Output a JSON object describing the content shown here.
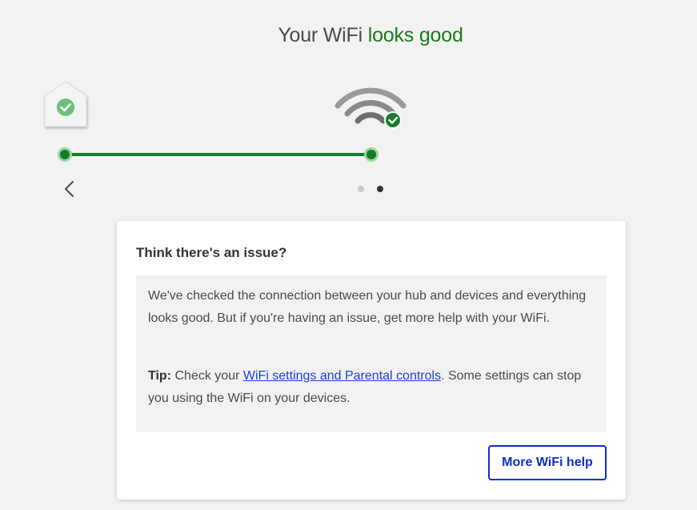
{
  "header": {
    "title_prefix": "Your WiFi ",
    "title_highlight": "looks good"
  },
  "diagram": {
    "hub_icon": "house-hub-icon",
    "wifi_icon": "wifi-signal-icon",
    "status_icon": "check-circle-icon"
  },
  "carousel": {
    "back_icon": "chevron-left-icon",
    "page_count": 2,
    "active_page": 2
  },
  "card": {
    "heading": "Think there's an issue?",
    "paragraph1": "We've checked the connection between your hub and devices and everything looks good. But if you're having an issue, get more help with your WiFi.",
    "tip_label": "Tip:",
    "tip_before": " Check your ",
    "tip_link": "WiFi settings and Parental controls",
    "tip_after": ". Some settings can stop you using the WiFi on your devices.",
    "button_label": "More WiFi help"
  },
  "colors": {
    "accent_green": "#147d2a",
    "link_blue": "#1a3fd6",
    "button_blue": "#0f2fc4",
    "background": "#f2f2f2"
  }
}
